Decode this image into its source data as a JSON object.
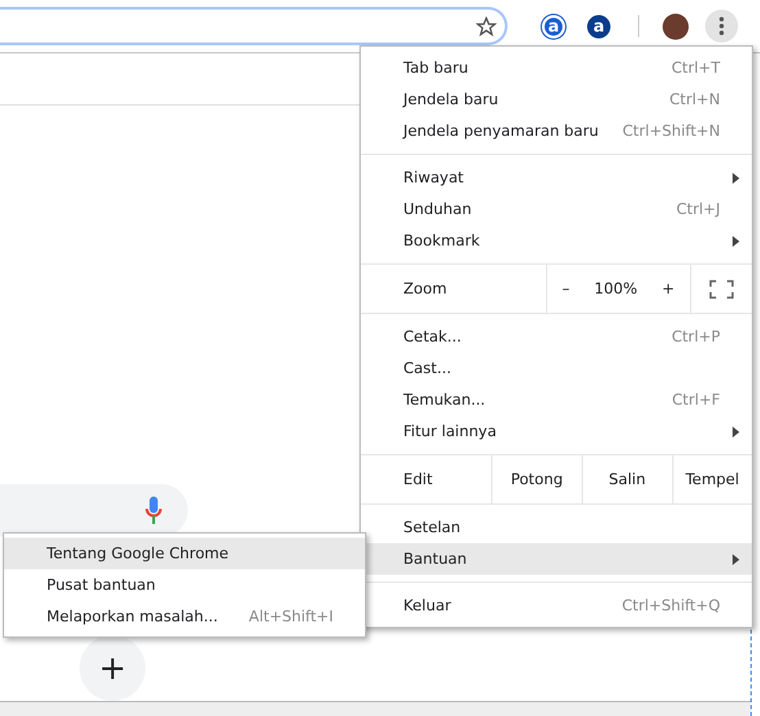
{
  "toolbar": {
    "extensions": [
      {
        "letter": "a"
      },
      {
        "letter": "a"
      }
    ]
  },
  "menu": {
    "items": [
      {
        "kind": "item",
        "label": "Tab baru",
        "shortcut": "Ctrl+T",
        "submenu": false,
        "selected": false
      },
      {
        "kind": "item",
        "label": "Jendela baru",
        "shortcut": "Ctrl+N",
        "submenu": false,
        "selected": false
      },
      {
        "kind": "item",
        "label": "Jendela penyamaran baru",
        "shortcut": "Ctrl+Shift+N",
        "submenu": false,
        "selected": false
      },
      {
        "kind": "separator"
      },
      {
        "kind": "item",
        "label": "Riwayat",
        "submenu": true,
        "selected": false
      },
      {
        "kind": "item",
        "label": "Unduhan",
        "shortcut": "Ctrl+J",
        "submenu": false,
        "selected": false
      },
      {
        "kind": "item",
        "label": "Bookmark",
        "submenu": true,
        "selected": false
      },
      {
        "kind": "separator"
      },
      {
        "kind": "zoom",
        "label": "Zoom",
        "minus": "–",
        "value": "100%",
        "plus": "+"
      },
      {
        "kind": "separator"
      },
      {
        "kind": "item",
        "label": "Cetak...",
        "shortcut": "Ctrl+P",
        "submenu": false,
        "selected": false
      },
      {
        "kind": "item",
        "label": "Cast...",
        "submenu": false,
        "selected": false
      },
      {
        "kind": "item",
        "label": "Temukan...",
        "shortcut": "Ctrl+F",
        "submenu": false,
        "selected": false
      },
      {
        "kind": "item",
        "label": "Fitur lainnya",
        "submenu": true,
        "selected": false
      },
      {
        "kind": "separator"
      },
      {
        "kind": "edit",
        "label": "Edit",
        "buttons": [
          "Potong",
          "Salin",
          "Tempel"
        ]
      },
      {
        "kind": "separator"
      },
      {
        "kind": "item",
        "label": "Setelan",
        "submenu": false,
        "selected": false
      },
      {
        "kind": "item",
        "label": "Bantuan",
        "submenu": true,
        "selected": true
      },
      {
        "kind": "separator"
      },
      {
        "kind": "item",
        "label": "Keluar",
        "shortcut": "Ctrl+Shift+Q",
        "submenu": false,
        "selected": false
      }
    ]
  },
  "submenu": {
    "items": [
      {
        "label": "Tentang Google Chrome",
        "selected": true
      },
      {
        "label": "Pusat bantuan",
        "selected": false
      },
      {
        "label": "Melaporkan masalah...",
        "shortcut": "Alt+Shift+I",
        "selected": false
      }
    ]
  },
  "shortcut_tile": {
    "symbol": "+"
  }
}
